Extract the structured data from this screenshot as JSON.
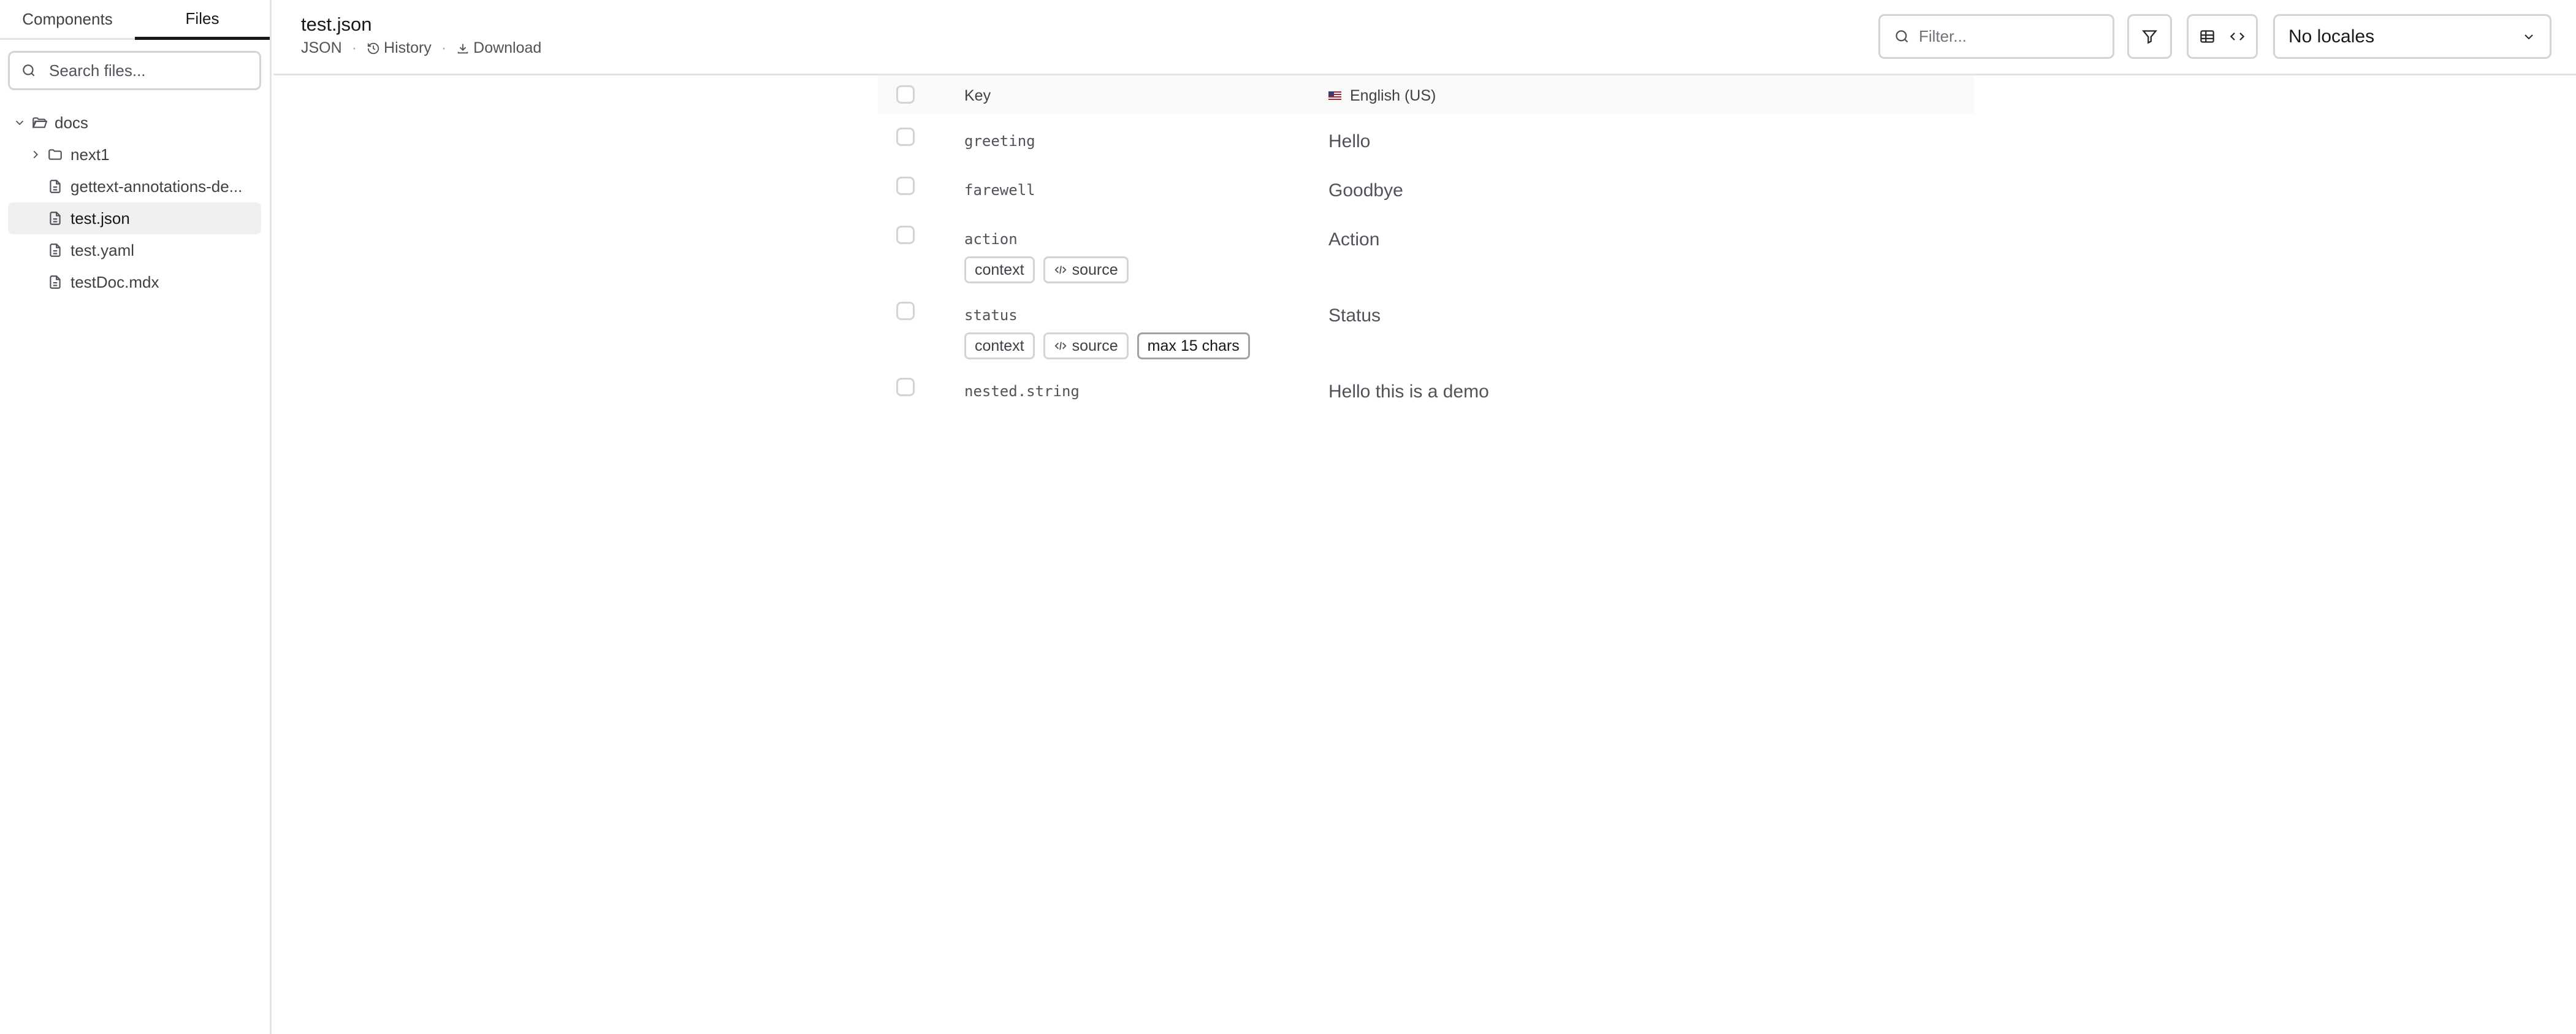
{
  "sidebar": {
    "tabs": [
      {
        "label": "Components",
        "active": false
      },
      {
        "label": "Files",
        "active": true
      }
    ],
    "search_placeholder": "Search files...",
    "tree": {
      "root": "docs",
      "folder": "next1",
      "files": [
        "gettext-annotations-de...",
        "test.json",
        "test.yaml",
        "testDoc.mdx"
      ],
      "selected": "test.json"
    }
  },
  "header": {
    "title": "test.json",
    "format": "JSON",
    "history_label": "History",
    "download_label": "Download",
    "filter_placeholder": "Filter...",
    "locale_label": "No locales"
  },
  "table": {
    "key_header": "Key",
    "locale_header": "English (US)",
    "rows": [
      {
        "key": "greeting",
        "value": "Hello",
        "badges": []
      },
      {
        "key": "farewell",
        "value": "Goodbye",
        "badges": []
      },
      {
        "key": "action",
        "value": "Action",
        "badges": [
          "context",
          "source"
        ]
      },
      {
        "key": "status",
        "value": "Status",
        "badges": [
          "context",
          "source",
          "max 15 chars"
        ]
      },
      {
        "key": "nested.string",
        "value": "Hello this is a demo",
        "badges": []
      }
    ]
  },
  "icons": {
    "search": "search-icon",
    "folder_open": "folder-open-icon",
    "folder": "folder-icon",
    "file": "file-icon",
    "history": "history-icon",
    "download": "download-icon",
    "filter": "filter-icon",
    "table": "table-icon",
    "code": "code-icon",
    "chevron_down": "chevron-down-icon"
  }
}
